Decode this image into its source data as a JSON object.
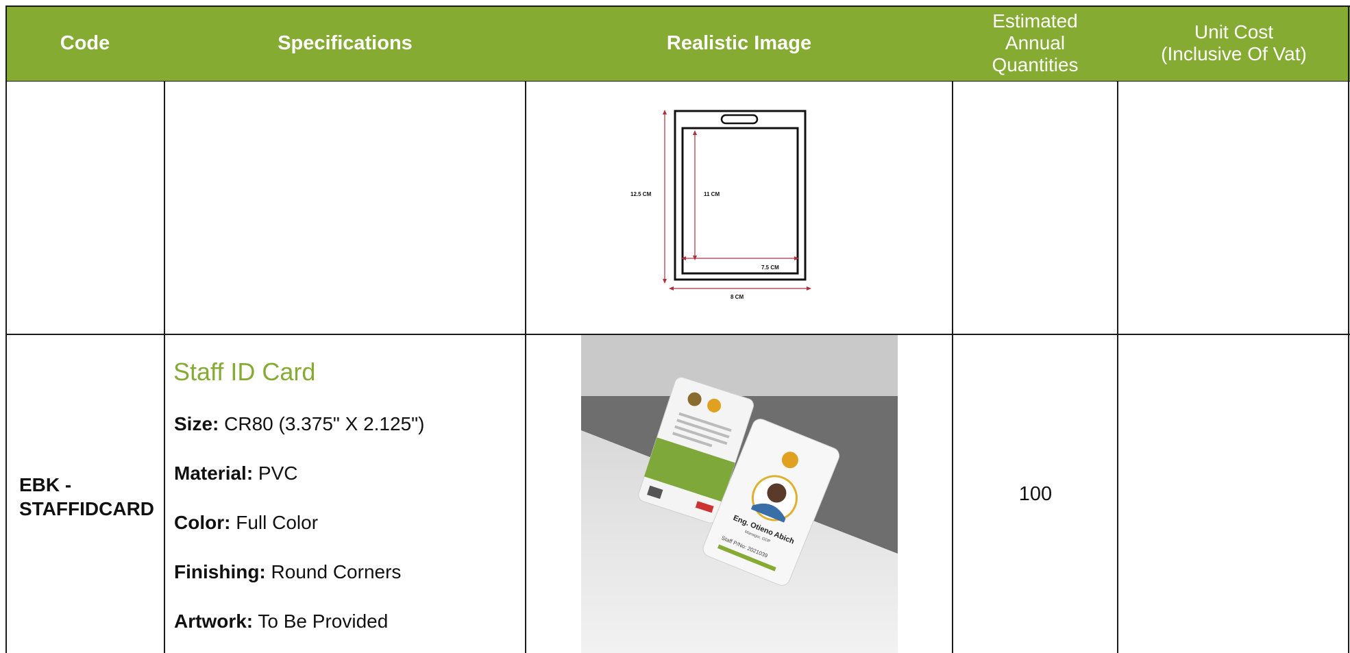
{
  "header": {
    "code": "Code",
    "specifications": "Specifications",
    "realistic_image": "Realistic Image",
    "quantities_line1": "Estimated",
    "quantities_line2": "Annual",
    "quantities_line3": "Quantities",
    "unit_cost_line1": "Unit Cost",
    "unit_cost_line2": "(Inclusive Of Vat)"
  },
  "diagram": {
    "outer_height": "12.5 CM",
    "inner_height": "11 CM",
    "inner_width": "7.5 CM",
    "outer_width": "8 CM"
  },
  "row": {
    "code_line1": "EBK -",
    "code_line2": "STAFFIDCARD",
    "title": "Staff ID Card",
    "specs": [
      {
        "label": "Size:",
        "value": " CR80 (3.375\" X 2.125\")"
      },
      {
        "label": "Material:",
        "value": " PVC"
      },
      {
        "label": "Color:",
        "value": " Full Color"
      },
      {
        "label": "Finishing:",
        "value": " Round Corners"
      },
      {
        "label": "Artwork:",
        "value": " To Be Provided"
      }
    ],
    "quantity": "100",
    "unit_cost": ""
  },
  "photo": {
    "card_name": "Eng. Otieno Abich",
    "card_role": "Manager, GDP",
    "card_staff_no": "Staff P/No: 2021039"
  },
  "colors": {
    "header_green": "#86ab33",
    "title_green": "#86ab33",
    "border": "#1a1a1a"
  }
}
